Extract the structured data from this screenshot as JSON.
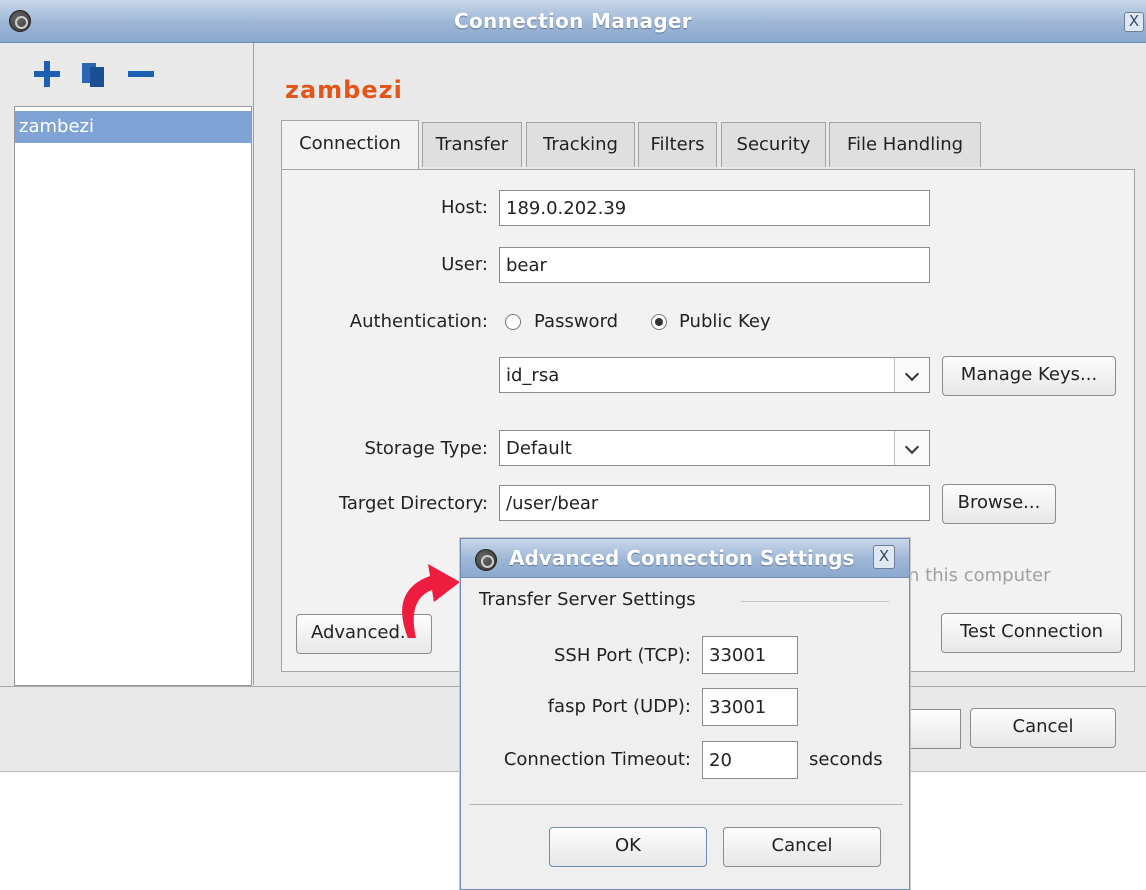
{
  "window": {
    "title": "Connection Manager",
    "close_glyph": "X"
  },
  "sidebar": {
    "toolbar": {
      "add_icon": "plus-icon",
      "duplicate_icon": "duplicate-icon",
      "remove_icon": "minus-icon"
    },
    "items": [
      {
        "label": "zambezi",
        "selected": true
      }
    ]
  },
  "connection": {
    "name": "zambezi",
    "tabs": [
      "Connection",
      "Transfer",
      "Tracking",
      "Filters",
      "Security",
      "File Handling"
    ],
    "active_tab": "Connection",
    "host": {
      "label": "Host:",
      "value": "189.0.202.39"
    },
    "user": {
      "label": "User:",
      "value": "bear"
    },
    "authentication": {
      "label": "Authentication:",
      "options": [
        "Password",
        "Public Key"
      ],
      "selected": "Public Key"
    },
    "key": {
      "value": "id_rsa",
      "manage_button": "Manage Keys..."
    },
    "storage": {
      "label": "Storage Type:",
      "value": "Default"
    },
    "target": {
      "label": "Target Directory:",
      "value": "/user/bear",
      "browse_button": "Browse..."
    },
    "hidden_text": "n this computer",
    "advanced_button": "Advanced...",
    "test_button": "Test Connection"
  },
  "footer": {
    "cancel_button": "Cancel"
  },
  "dialog": {
    "title": "Advanced Connection Settings",
    "close_glyph": "X",
    "section": "Transfer Server Settings",
    "ssh": {
      "label": "SSH Port (TCP):",
      "value": "33001"
    },
    "fasp": {
      "label": "fasp Port (UDP):",
      "value": "33001"
    },
    "timeout": {
      "label": "Connection Timeout:",
      "value": "20",
      "unit": "seconds"
    },
    "ok_button": "OK",
    "cancel_button": "Cancel"
  },
  "annotation": {
    "icon": "curved-red-arrow-icon",
    "color": "#ee1d3f"
  },
  "colors": {
    "title_accent": "#e2561b",
    "selection": "#7fa3d5",
    "titlebar": "#9db6d6"
  }
}
